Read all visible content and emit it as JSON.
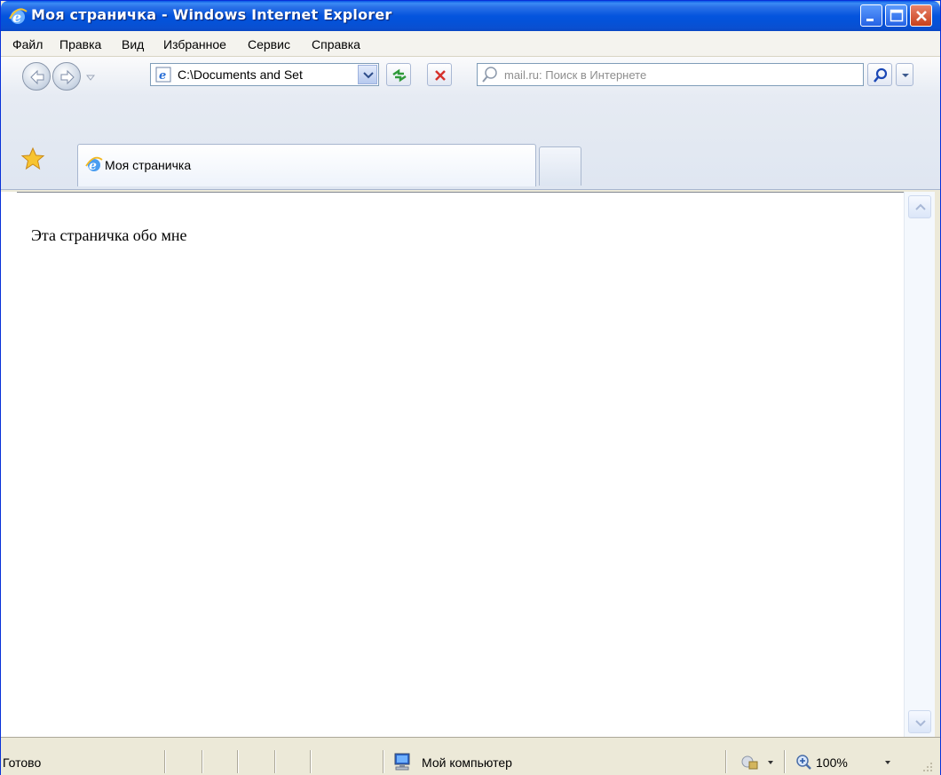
{
  "window": {
    "title": "Моя страничка - Windows Internet Explorer"
  },
  "menu": {
    "items": [
      "Файл",
      "Правка",
      "Вид",
      "Избранное",
      "Сервис",
      "Справка"
    ]
  },
  "nav": {
    "address_value": "C:\\Documents and Set",
    "search_placeholder": "mail.ru: Поиск в Интернете"
  },
  "tabs": [
    {
      "label": "Моя страничка",
      "active": true
    }
  ],
  "page": {
    "text": "Эта страничка обо мне"
  },
  "status": {
    "text": "Готово",
    "zone": "Мой компьютер",
    "zoom": "100%"
  },
  "colors": {
    "titlebar": "#0454de",
    "close_button": "#c8411c"
  },
  "icons": {
    "title": "ie-icon",
    "favorites": "star-icon",
    "zone": "computer-icon",
    "zoom": "magnifier-icon"
  }
}
